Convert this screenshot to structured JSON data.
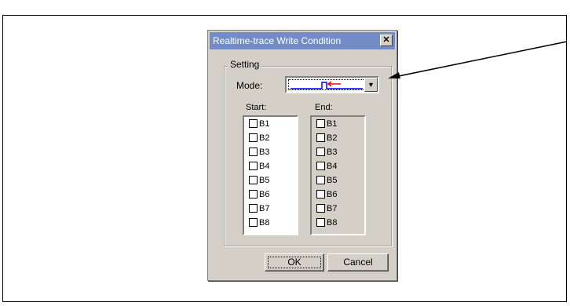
{
  "dialog": {
    "title": "Realtime-trace Write Condition",
    "close_label": "✕"
  },
  "setting": {
    "group_label": "Setting",
    "mode_label": "Mode:",
    "mode_icon": "write-pulse-icon"
  },
  "start": {
    "label": "Start:",
    "items": [
      "B1",
      "B2",
      "B3",
      "B4",
      "B5",
      "B6",
      "B7",
      "B8"
    ]
  },
  "end": {
    "label": "End:",
    "items": [
      "B1",
      "B2",
      "B3",
      "B4",
      "B5",
      "B6",
      "B7",
      "B8"
    ]
  },
  "buttons": {
    "ok": "OK",
    "cancel": "Cancel"
  },
  "colors": {
    "titlebar": "#748cc5",
    "mode_wave": "#0000ff",
    "mode_arrow": "#ff0000"
  }
}
